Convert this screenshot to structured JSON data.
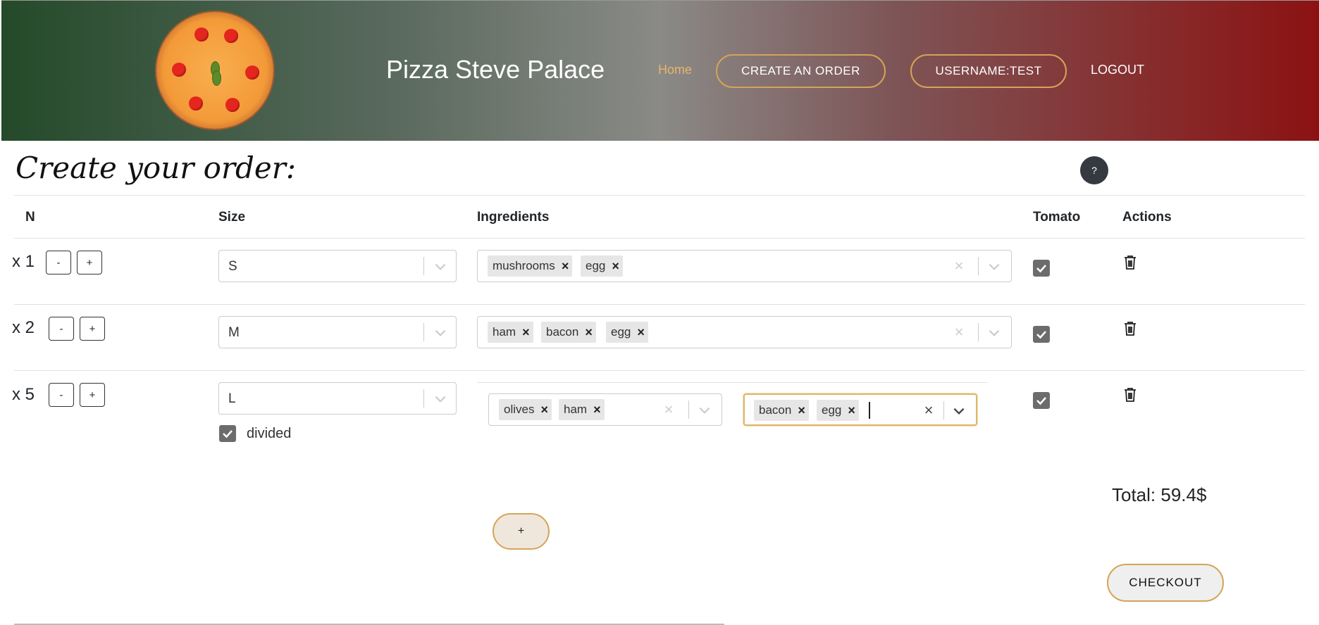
{
  "header": {
    "brand": "Pizza Steve Palace",
    "nav": {
      "home": "Home",
      "create_order": "CREATE AN ORDER",
      "username": "USERNAME:TEST",
      "logout": "LOGOUT"
    },
    "colors": {
      "gradient_start": "#244a2a",
      "gradient_mid": "#8a8a87",
      "gradient_end": "#8c1212",
      "accent": "#d4a457",
      "home_link": "#e8b56a"
    }
  },
  "page": {
    "title": "Create your order:",
    "help_label": "?"
  },
  "table": {
    "headers": {
      "n": "N",
      "size": "Size",
      "ingredients": "Ingredients",
      "tomato": "Tomato",
      "actions": "Actions"
    },
    "rows": [
      {
        "quantity": "x 1",
        "minus": "-",
        "plus": "+",
        "size": "S",
        "ingredients": [
          "mushrooms",
          "egg"
        ],
        "tomato": true
      },
      {
        "quantity": "x 2",
        "minus": "-",
        "plus": "+",
        "size": "M",
        "ingredients": [
          "ham",
          "bacon",
          "egg"
        ],
        "tomato": true
      },
      {
        "quantity": "x 5",
        "minus": "-",
        "plus": "+",
        "size": "L",
        "divided": true,
        "divided_label": "divided",
        "ingredients_left": [
          "olives",
          "ham"
        ],
        "ingredients_right": [
          "bacon",
          "egg"
        ],
        "tomato": true
      }
    ]
  },
  "footer": {
    "add_pizza": "+",
    "total": "Total: 59.4$",
    "checkout": "CHECKOUT"
  },
  "icons": {
    "remove": "close-icon",
    "dropdown": "chevron-down-icon",
    "delete": "trash-icon",
    "checkbox": "checkmark-icon"
  }
}
